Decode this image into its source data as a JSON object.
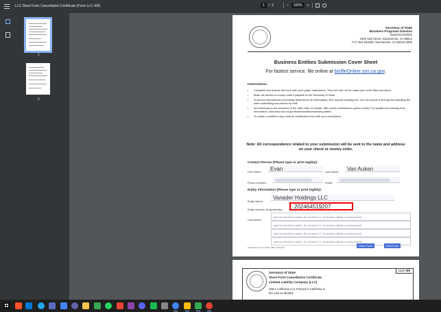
{
  "viewer": {
    "title": "LLC Short Form Cancellation Certificate (Form LLC-4/8)",
    "page_current": "1",
    "page_sep": "/",
    "page_total": "2",
    "zoom_minus": "–",
    "zoom_value": "100%",
    "zoom_plus": "+",
    "thumbs": [
      {
        "label": "1"
      },
      {
        "label": "2"
      }
    ]
  },
  "form": {
    "agency": "Secretary of State",
    "division": "Business Programs Division",
    "unit": "Business Entities",
    "address": "1500 11th Street, Sacramento, CA 95814",
    "pobox": "P.O. Box 944260, Sacramento, CA 94244-2600",
    "heading": "Business Entities Submission Cover Sheet",
    "online_prefix": "For fastest service, file online at ",
    "online_link": "bizfileOnline.sos.ca.gov",
    "online_suffix": ".",
    "instructions_label": "Instructions:",
    "bullets": [
      "Complete and include this form with your paper submission. This form will not be made part of the filed document.",
      "Make all checks or money orders payable to the Secretary of State.",
      "In-person submissions (excluding Statements of Information): $15 special handling fee. Do not include a $15 special handling fee when submitting documents by mail.",
      "All submissions are reviewed in the date order of receipt. With online submissions given priority. For updated processing time information, visit www.sos.ca.gov/business/be/processing-dates.",
      "To obtain a certified copy, include certification fees with your submission."
    ],
    "note": "Note: All correspondence related to your submission will be sent to the name and address on your check or money order.",
    "contact_label": "Contact Person (Please type or print legibly):",
    "first_name_label": "First Name:",
    "first_name": "Evan",
    "last_name_label": "Last Name:",
    "last_name": "Van Auken",
    "phone_label": "Phone Number:",
    "email_label": "Email:",
    "entity_label": "Entity Information (Please type or print legibly):",
    "entity_name_label": "Entity Name:",
    "entity_name": "Vanader Holdings LLC",
    "entity_number_label": "Entity Number (if applicable):",
    "entity_number": "202464519207",
    "comments_label": "Comments:",
    "comment_lines": [
      "open for less than 6 months. Do not meet LLC. No business activity or money earned.",
      "open for less than 6 months. Do not meet LLC. No business activity or money earned.",
      "open for less than 6 months. Do not meet LLC. No business activity or money earned.",
      "open for less than 6 months. Do not meet LLC. No business activity or money earned."
    ],
    "footer": "Submission Cover Sheet (REV 2023-04)",
    "clear_btn": "Clear Form",
    "print_btn": "Print Form"
  },
  "page2": {
    "agency": "Secretary of State",
    "title1": "Short Form Cancellation Certificate",
    "title2": "Limited Liability Company (LLC)",
    "form_code": "LLC-4/8",
    "line1": "ONLY California LLC Formed in California in",
    "line2": "the Last 12 Months"
  },
  "taskbar": {
    "apps": [
      "windows-icon",
      "brave-icon",
      "edge-icon",
      "vscode-icon",
      "app-icon",
      "chrome-icon",
      "teams-icon",
      "file-explorer-icon",
      "chrome-icon",
      "whatsapp-icon",
      "chrome-icon",
      "app-icon",
      "discord-icon",
      "spotify-icon",
      "app-icon",
      "chrome-icon",
      "chrome-icon",
      "chrome-icon",
      "chrome-icon"
    ],
    "colors": [
      "#ffffff",
      "#fb542b",
      "#0078d4",
      "#23a6f0",
      "#5c6bc0",
      "#4285f4",
      "#6264a7",
      "#f8c74a",
      "#34a853",
      "#25d366",
      "#ea4335",
      "#8e44ad",
      "#5865f2",
      "#1db954",
      "#888888",
      "#4285f4",
      "#fbbc05",
      "#34a853",
      "#ea4335"
    ]
  }
}
